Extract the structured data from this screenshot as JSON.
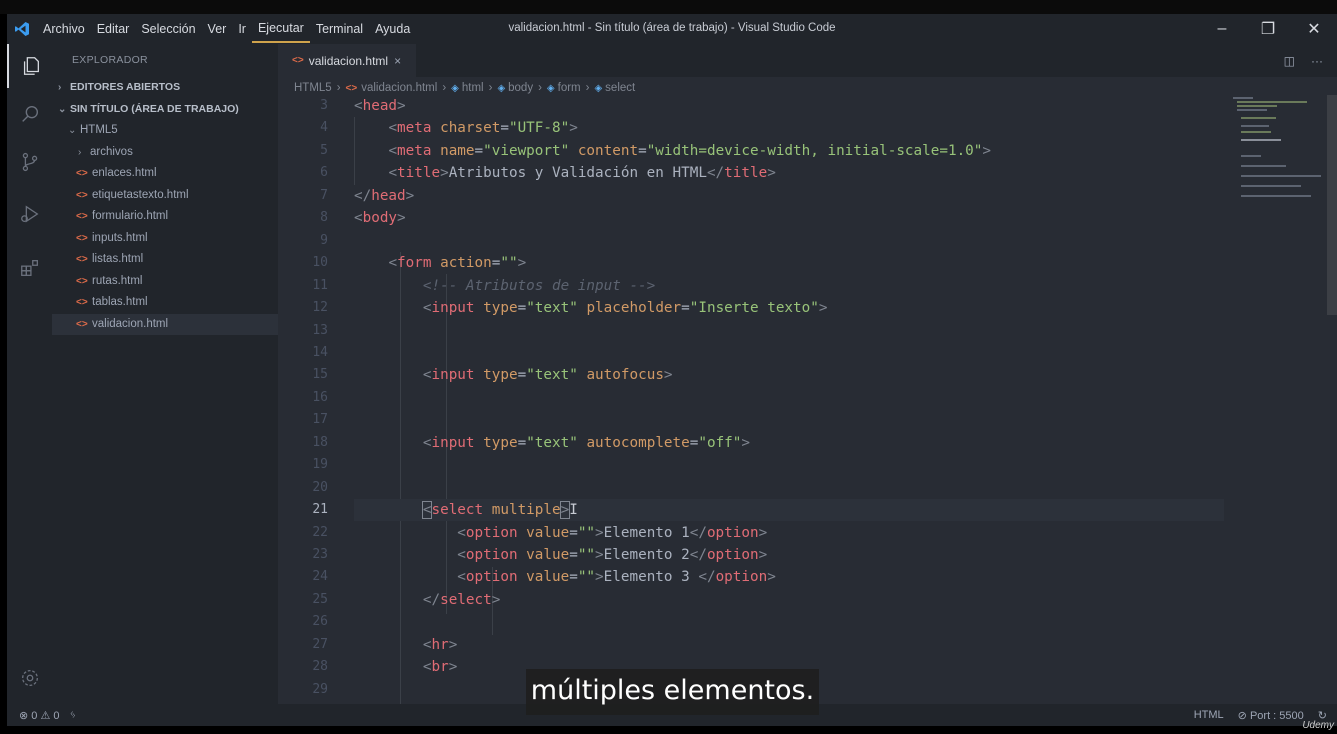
{
  "window": {
    "title": "validacion.html - Sin título (área de trabajo) - Visual Studio Code",
    "menu": [
      "Archivo",
      "Editar",
      "Selección",
      "Ver",
      "Ir",
      "Ejecutar",
      "Terminal",
      "Ayuda"
    ],
    "active_menu_index": 5,
    "controls": {
      "minimize": "–",
      "restore": "❐",
      "close": "✕"
    }
  },
  "activity_bar": {
    "items": [
      "explorer-icon",
      "search-icon",
      "source-control-icon",
      "run-debug-icon",
      "extensions-icon"
    ],
    "bottom": "gear-icon"
  },
  "sidebar": {
    "title": "EXPLORADOR",
    "sections": {
      "open_editors": "EDITORES ABIERTOS",
      "workspace": "SIN TÍTULO (ÁREA DE TRABAJO)",
      "folder": "HTML5",
      "subfolder": "archivos"
    },
    "files": [
      "enlaces.html",
      "etiquetastexto.html",
      "formulario.html",
      "inputs.html",
      "listas.html",
      "rutas.html",
      "tablas.html",
      "validacion.html"
    ],
    "selected_file": "validacion.html"
  },
  "editor": {
    "tab": {
      "label": "validacion.html",
      "close": "×"
    },
    "actions": {
      "split": "◫",
      "more": "···"
    },
    "breadcrumb": [
      "HTML5",
      "validacion.html",
      "html",
      "body",
      "form",
      "select"
    ],
    "current_line": 21
  },
  "code_lines": [
    {
      "n": "3"
    },
    {
      "n": "4"
    },
    {
      "n": "5"
    },
    {
      "n": "6"
    },
    {
      "n": "7"
    },
    {
      "n": "8"
    },
    {
      "n": "9"
    },
    {
      "n": "10"
    },
    {
      "n": "11"
    },
    {
      "n": "12"
    },
    {
      "n": "13"
    },
    {
      "n": "14"
    },
    {
      "n": "15"
    },
    {
      "n": "16"
    },
    {
      "n": "17"
    },
    {
      "n": "18"
    },
    {
      "n": "19"
    },
    {
      "n": "20"
    },
    {
      "n": "21"
    },
    {
      "n": "22"
    },
    {
      "n": "23"
    },
    {
      "n": "24"
    },
    {
      "n": "25"
    },
    {
      "n": "26"
    },
    {
      "n": "27"
    },
    {
      "n": "28"
    },
    {
      "n": "29"
    }
  ],
  "code": {
    "l3_tag": "head",
    "l4_tag": "meta",
    "l4_attr": "charset",
    "l4_val": "\"UTF-8\"",
    "l5_tag": "meta",
    "l5_attr1": "name",
    "l5_val1": "\"viewport\"",
    "l5_attr2": "content",
    "l5_val2": "\"width=device-width, initial-scale=1.0\"",
    "l6_tag": "title",
    "l6_text": "Atributos y Validación en HTML",
    "l7_tag": "head",
    "l8_tag": "body",
    "l10_tag": "form",
    "l10_attr": "action",
    "l10_val": "\"\"",
    "l11_comment": "<!-- Atributos de input -->",
    "l12_tag": "input",
    "l12_attr1": "type",
    "l12_val1": "\"text\"",
    "l12_attr2": "placeholder",
    "l12_val2": "\"Inserte texto\"",
    "l15_tag": "input",
    "l15_attr1": "type",
    "l15_val1": "\"text\"",
    "l15_attr2": "autofocus",
    "l18_tag": "input",
    "l18_attr1": "type",
    "l18_val1": "\"text\"",
    "l18_attr2": "autocomplete",
    "l18_val2": "\"off\"",
    "l21_tag": "select",
    "l21_attr": "multiple",
    "opt_tag": "option",
    "opt_attr": "value",
    "opt_val": "\"\"",
    "l22_text": "Elemento 1",
    "l23_text": "Elemento 2",
    "l24_text": "Elemento 3 ",
    "l25_tag": "select",
    "l27_tag": "hr",
    "l28_tag": "br"
  },
  "status_bar": {
    "errors": "0",
    "warnings": "0",
    "language": "HTML",
    "port": "Port : 5500"
  },
  "caption": "múltiples elementos.",
  "watermark": "Udemy"
}
